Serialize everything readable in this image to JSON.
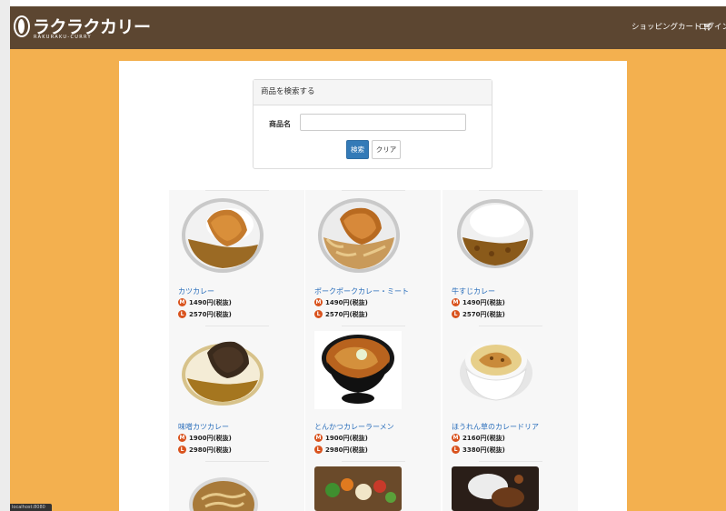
{
  "header": {
    "brand_title": "ラクラクカリー",
    "brand_subtitle": "RAKURAKU-CURRY",
    "cart_label": "ショッピングカート",
    "cart_icon": "cart-icon",
    "login_label": "ログイン"
  },
  "search": {
    "panel_title": "商品を検索する",
    "field_label": "商品名",
    "input_value": "",
    "search_button": "検索",
    "clear_button": "クリア"
  },
  "products": [
    {
      "name": "カツカレー",
      "m_price": "1490円(税抜)",
      "l_price": "2570円(税抜)"
    },
    {
      "name": "ポークポークカレー・ミート",
      "m_price": "1490円(税抜)",
      "l_price": "2570円(税抜)"
    },
    {
      "name": "牛すじカレー",
      "m_price": "1490円(税抜)",
      "l_price": "2570円(税抜)"
    },
    {
      "name": "味噌カツカレー",
      "m_price": "1900円(税抜)",
      "l_price": "2980円(税抜)"
    },
    {
      "name": "とんかつカレーラーメン",
      "m_price": "1900円(税抜)",
      "l_price": "2980円(税抜)"
    },
    {
      "name": "ほうれん草のカレードリア",
      "m_price": "2160円(税抜)",
      "l_price": "3380円(税抜)"
    }
  ],
  "size_badges": {
    "m": "M",
    "l": "L"
  },
  "status_text": "localhost:8080",
  "colors": {
    "navbar": "#5c4631",
    "page_background": "#f3b04f",
    "link": "#2a6ebb",
    "primary_button": "#337ab7",
    "badge": "#d9531e"
  }
}
